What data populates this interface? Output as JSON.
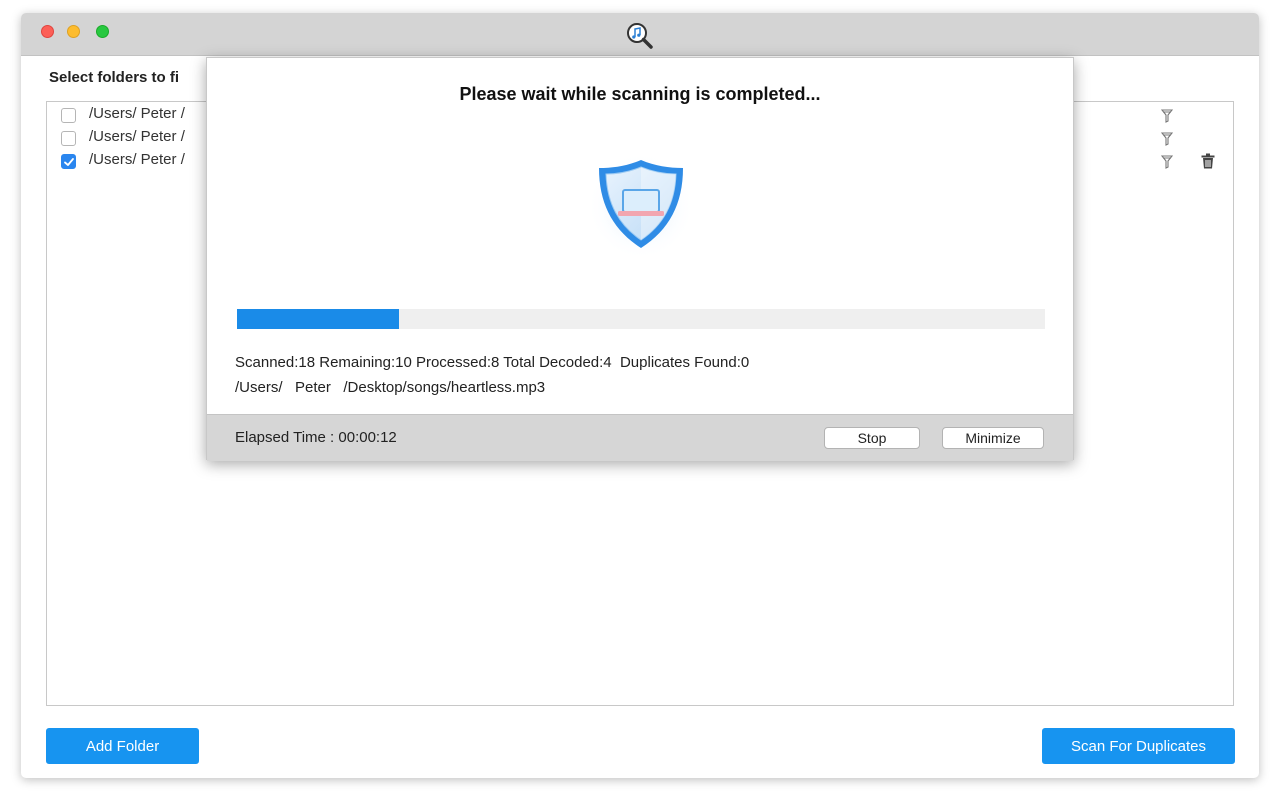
{
  "window": {
    "app_icon": "music-search-icon"
  },
  "main": {
    "heading": "Select folders to fi",
    "folders": [
      {
        "path": "/Users/  Peter  /",
        "checked": false
      },
      {
        "path": "/Users/  Peter  /",
        "checked": false
      },
      {
        "path": "/Users/  Peter  /",
        "checked": true
      }
    ],
    "add_folder_label": "Add Folder",
    "scan_label": "Scan For Duplicates"
  },
  "dialog": {
    "title": "Please wait while scanning is completed...",
    "shield_icon": "shield-laptop-icon",
    "progress": 0.2,
    "stats": "Scanned:18 Remaining:10 Processed:8 Total Decoded:4  Duplicates Found:0",
    "current_file": "/Users/   Peter   /Desktop/songs/heartless.mp3",
    "elapsed": "Elapsed Time : 00:00:12",
    "stop_label": "Stop",
    "minimize_label": "Minimize"
  },
  "colors": {
    "accent": "#1794f0",
    "progress": "#1a8be8",
    "checkbox_checked": "#2a86ef"
  }
}
